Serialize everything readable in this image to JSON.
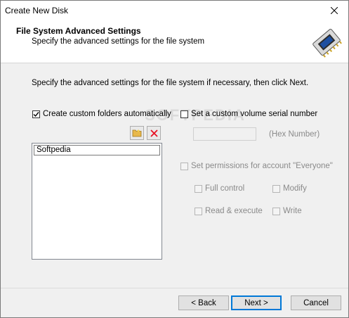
{
  "window": {
    "title": "Create New Disk"
  },
  "header": {
    "title": "File System Advanced Settings",
    "subtitle": "Specify the advanced settings for the file system"
  },
  "instruction": "Specify the advanced settings for the file system if necessary, then click Next.",
  "custom_folders": {
    "label": "Create custom folders automatically",
    "checked": true,
    "items": [
      "Softpedia"
    ]
  },
  "serial": {
    "label": "Set a custom volume serial number",
    "checked": false,
    "value": "",
    "hint": "(Hex Number)"
  },
  "permissions": {
    "label": "Set permissions for account \"Everyone\"",
    "full_control": "Full control",
    "modify": "Modify",
    "read_execute": "Read & execute",
    "write": "Write"
  },
  "buttons": {
    "back": "< Back",
    "next": "Next >",
    "cancel": "Cancel"
  },
  "watermark": "SOFTPEDIA",
  "colors": {
    "accent": "#0078d7",
    "delete_icon": "#e81123",
    "folder_icon": "#e8b84a"
  }
}
